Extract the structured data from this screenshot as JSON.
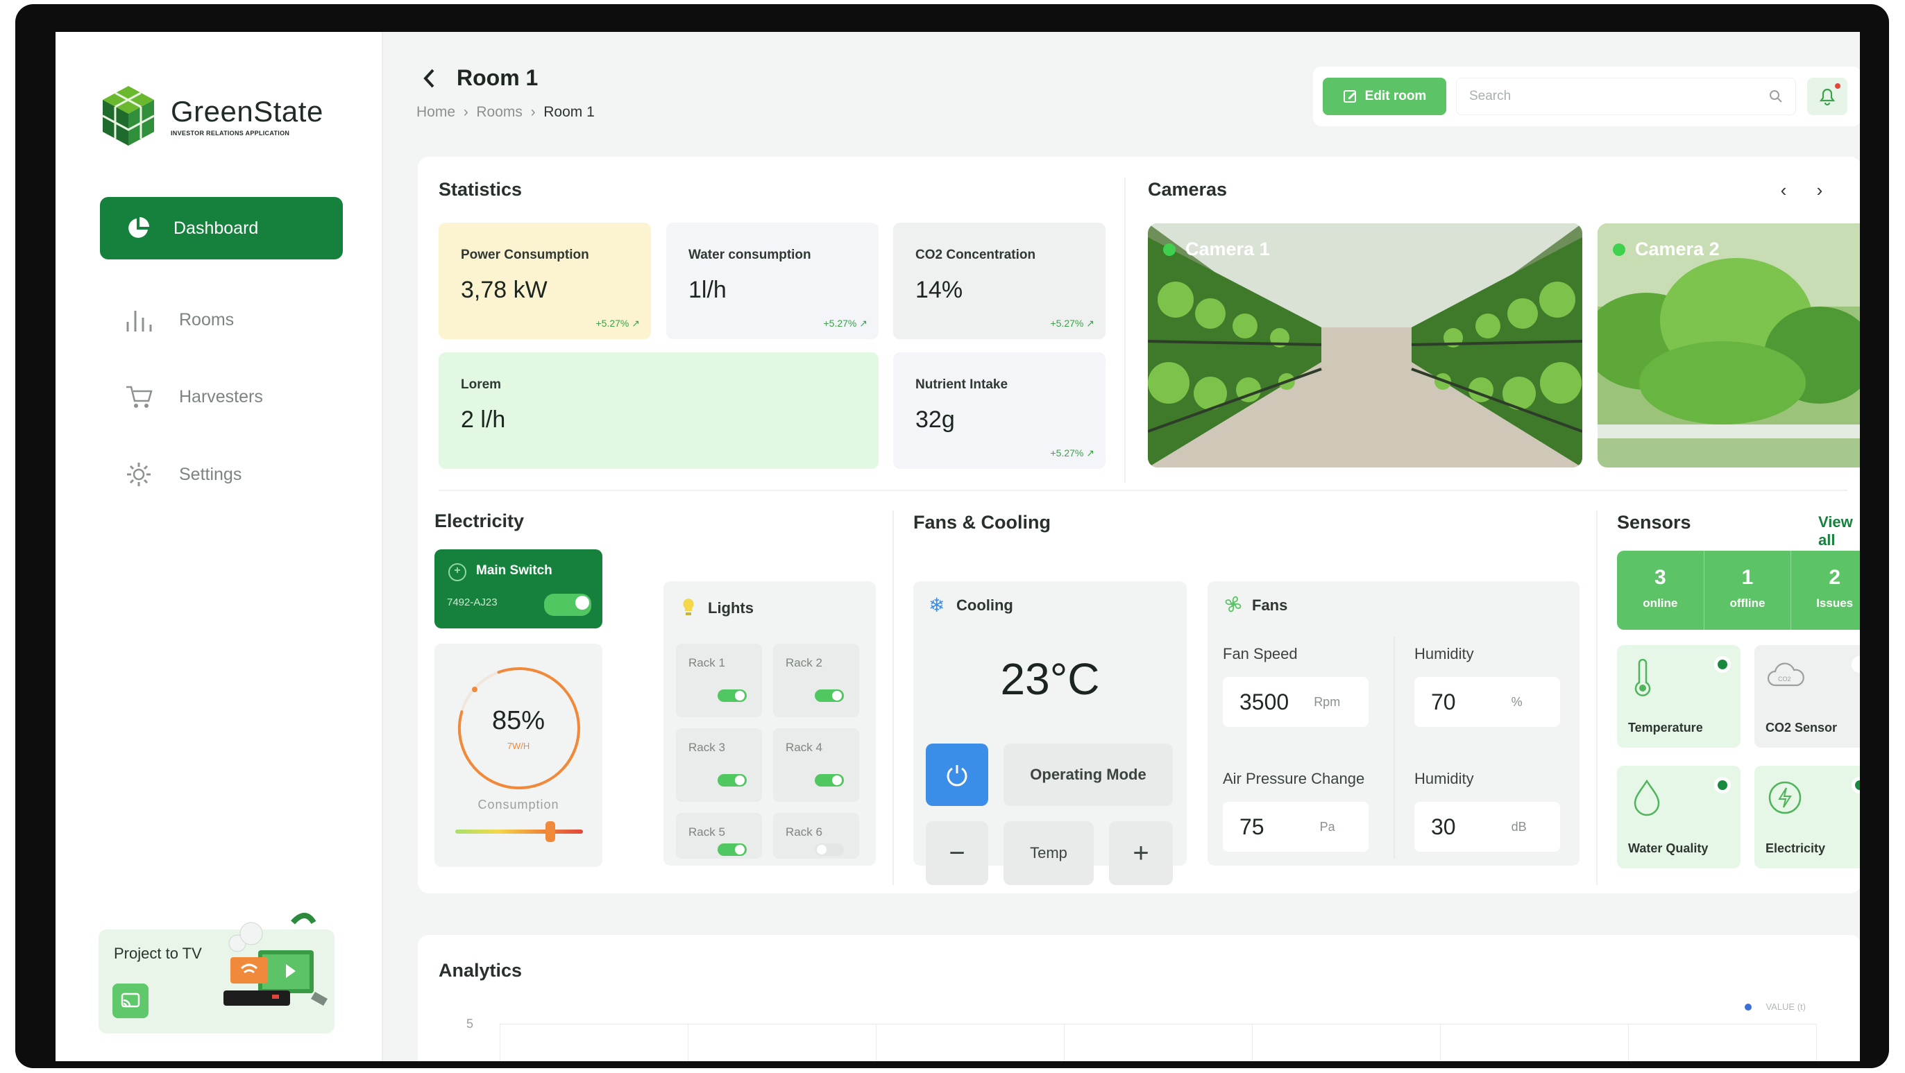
{
  "app": {
    "name": "GreenState",
    "tagline": "INVESTOR RELATIONS APPLICATION"
  },
  "sidebar": {
    "items": [
      {
        "label": "Dashboard",
        "active": true,
        "icon": "pie-chart-icon"
      },
      {
        "label": "Rooms",
        "icon": "bars-icon"
      },
      {
        "label": "Harvesters",
        "icon": "cart-icon"
      },
      {
        "label": "Settings",
        "icon": "gear-icon"
      }
    ],
    "project_tv": "Project to TV"
  },
  "header": {
    "title": "Room 1",
    "breadcrumb": [
      "Home",
      "Rooms",
      "Room 1"
    ],
    "edit_label": "Edit room",
    "search_placeholder": "Search"
  },
  "statistics": {
    "title": "Statistics",
    "cards": [
      {
        "label": "Power Consumption",
        "value": "3,78 kW",
        "change": "+5.27%"
      },
      {
        "label": "Water consumption",
        "value": "1l/h",
        "change": "+5.27%"
      },
      {
        "label": "CO2 Concentration",
        "value": "14%",
        "change": "+5.27%"
      },
      {
        "label": "Lorem",
        "value": "2 l/h"
      },
      {
        "label": "Nutrient Intake",
        "value": "32g",
        "change": "+5.27%"
      }
    ]
  },
  "cameras": {
    "title": "Cameras",
    "items": [
      {
        "label": "Camera 1"
      },
      {
        "label": "Camera 2"
      }
    ]
  },
  "electricity": {
    "title": "Electricity",
    "main_switch": {
      "label": "Main Switch",
      "id": "7492-AJ23",
      "on": true
    },
    "gauge": {
      "value": "85%",
      "unit": "7W/H",
      "label": "Consumption",
      "level": 0.85
    },
    "lights": {
      "title": "Lights",
      "racks": [
        {
          "label": "Rack 1",
          "on": true
        },
        {
          "label": "Rack 2",
          "on": true
        },
        {
          "label": "Rack 3",
          "on": true
        },
        {
          "label": "Rack 4",
          "on": true
        },
        {
          "label": "Rack 5",
          "on": true
        },
        {
          "label": "Rack 6",
          "on": false
        }
      ]
    }
  },
  "fans_cooling": {
    "title": "Fans & Cooling",
    "cooling": {
      "title": "Cooling",
      "temp": "23°C",
      "mode_label": "Operating Mode",
      "temp_label": "Temp",
      "minus": "−",
      "plus": "+"
    },
    "fans": {
      "title": "Fans",
      "fields": [
        {
          "label": "Fan Speed",
          "value": "3500",
          "unit": "Rpm"
        },
        {
          "label": "Humidity",
          "value": "70",
          "unit": "%"
        },
        {
          "label": "Air Pressure Change",
          "value": "75",
          "unit": "Pa"
        },
        {
          "label": "Humidity",
          "value": "30",
          "unit": "dB"
        }
      ]
    }
  },
  "sensors": {
    "title": "Sensors",
    "view_all": "View all",
    "summary": [
      {
        "value": "3",
        "label": "online"
      },
      {
        "value": "1",
        "label": "offline"
      },
      {
        "value": "2",
        "label": "Issues"
      }
    ],
    "items": [
      {
        "label": "Temperature",
        "status": "active"
      },
      {
        "label": "CO2 Sensor",
        "status": "inactive"
      },
      {
        "label": "Water Quality",
        "status": "active"
      },
      {
        "label": "Electricity",
        "status": "active"
      }
    ]
  },
  "analytics": {
    "title": "Analytics",
    "legend": "VALUE (t)",
    "y_tick": "5"
  },
  "colors": {
    "primary": "#16813c",
    "accent": "#5cc466",
    "blue": "#3b8ee8",
    "orange": "#f08a3a"
  }
}
